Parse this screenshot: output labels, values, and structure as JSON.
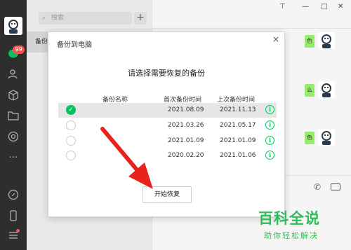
{
  "rail": {
    "badge": "99",
    "icons": [
      "chat-icon",
      "contacts-icon",
      "box-icon",
      "folder-icon",
      "moments-icon",
      "more-icon",
      "miniprogram-icon",
      "phone-icon",
      "menu-icon"
    ]
  },
  "list": {
    "search_placeholder": "搜索",
    "add_label": "+",
    "selected_row": "备份"
  },
  "chat": {
    "bubbles": [
      "色",
      "么",
      "色"
    ]
  },
  "dialog": {
    "title": "备份到电脑",
    "close": "×",
    "heading": "请选择需要恢复的备份",
    "columns": {
      "name": "备份名称",
      "first": "首次备份时间",
      "last": "上次备份时间"
    },
    "rows": [
      {
        "first": "2021.08.09",
        "last": "2021.11.13",
        "selected": true
      },
      {
        "first": "2021.03.26",
        "last": "2021.05.17",
        "selected": false
      },
      {
        "first": "2021.01.09",
        "last": "2021.01.09",
        "selected": false
      },
      {
        "first": "2020.02.20",
        "last": "2021.01.06",
        "selected": false
      }
    ],
    "start_button": "开始恢复"
  },
  "watermark": {
    "line1": "百科全说",
    "line2": "助你轻松解决"
  },
  "colors": {
    "accent": "#07c160",
    "arrow": "#e8231c",
    "watermark": "#2fbd5a"
  }
}
